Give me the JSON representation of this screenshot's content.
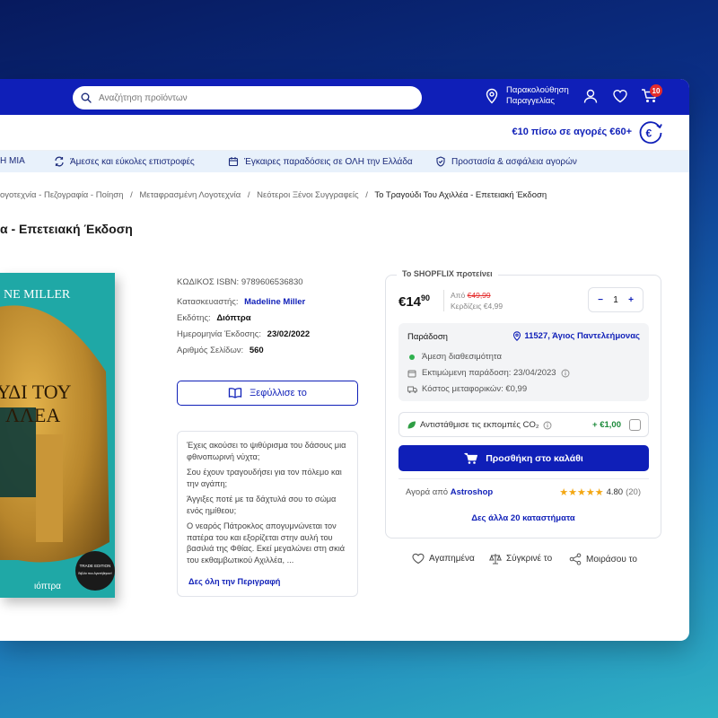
{
  "header": {
    "search_placeholder": "Αναζήτηση προϊόντων",
    "track_line1": "Παρακολούθηση",
    "track_line2": "Παραγγελίας",
    "cart_count": "10"
  },
  "promo": {
    "text": "€10 πίσω σε αγορές €60+"
  },
  "benefits": [
    "Η ΜΙΑ",
    "Άμεσες και εύκολες επιστροφές",
    "Έγκαιρες παραδόσεις σε ΟΛΗ την Ελλάδα",
    "Προστασία & ασφάλεια αγορών"
  ],
  "breadcrumbs": [
    "ογοτεχνία - Πεζογραφία - Ποίηση",
    "Μεταφρασμένη Λογοτεχνία",
    "Νεότεροι Ξένοι Συγγραφείς",
    "Το Τραγούδι Του Αχιλλέα - Επετειακή Έκδοση"
  ],
  "breadcrumb_sep": "/",
  "product": {
    "title": "α - Επετειακή Έκδοση",
    "isbn": "ΚΩΔΙΚΟΣ ISBN: 9789606536830",
    "manufacturer_label": "Κατασκευαστής:",
    "manufacturer": "Madeline Miller",
    "publisher_label": "Εκδότης:",
    "publisher": "Διόπτρα",
    "date_label": "Ημερομηνία Έκδοσης:",
    "date": "23/02/2022",
    "pages_label": "Αριθμός Σελίδων:",
    "pages": "560",
    "flip_label": "Ξεφύλλισε το",
    "cover_author": "NE MILLER",
    "cover_title1": "ΥΔΙ ΤΟΥ",
    "cover_title2": "ΛΛΕΑ",
    "cover_publisher": "ιόπτρα",
    "cover_badge1": "TRADE EDITION",
    "cover_badge2": "Βιβλία που Αγαπήθηκαν!"
  },
  "description": {
    "paragraphs": [
      "Έχεις ακούσει το ψιθύρισμα του δάσους μια φθινοπωρινή νύχτα;",
      "Σου έχουν τραγουδήσει για τον πόλεμο και την αγάπη;",
      "Άγγιξες ποτέ με τα δάχτυλά σου το σώμα ενός ημίθεου;",
      "Ο νεαρός Πάτροκλος απογυμνώνεται τον πατέρα του και εξορίζεται στην αυλή του βασιλιά της Φθίας. Εκεί μεγαλώνει στη σκιά του εκθαμβωτικού Αχιλλέα, ..."
    ],
    "more": "Δες όλη την Περιγραφή"
  },
  "buybox": {
    "tag": "Το SHOPFLIX προτείνει",
    "price_main": "€14",
    "price_cents": "90",
    "from_label": "Από",
    "old_price": "€49,99",
    "save": "Κερδίζεις €4,99",
    "qty": "1",
    "minus": "−",
    "plus": "+",
    "delivery_label": "Παράδοση",
    "location": "11527, Άγιος Παντελεήμονας",
    "availability": "Άμεση διαθεσιμότητα",
    "estimated": "Εκτιμώμενη παράδοση: 23/04/2023",
    "shipping": "Κόστος μεταφορικών: €0,99",
    "co2_label": "Αντιστάθμισε τις εκπομπές CO₂",
    "co2_amount": "+ €1,00",
    "cart_button": "Προσθήκη στο καλάθι",
    "seller_label": "Αγορά από",
    "seller": "Astroshop",
    "rating": "4.80",
    "rating_count": "(20)",
    "other_stores": "Δες άλλα 20 καταστήματα"
  },
  "actions": {
    "wishlist": "Αγαπημένα",
    "compare": "Σύγκρινέ το",
    "share": "Μοιράσου το"
  },
  "colors": {
    "brand": "#0f1fb8",
    "badge": "#e42b2b",
    "green": "#1b8a3a",
    "stars": "#f3a713"
  }
}
